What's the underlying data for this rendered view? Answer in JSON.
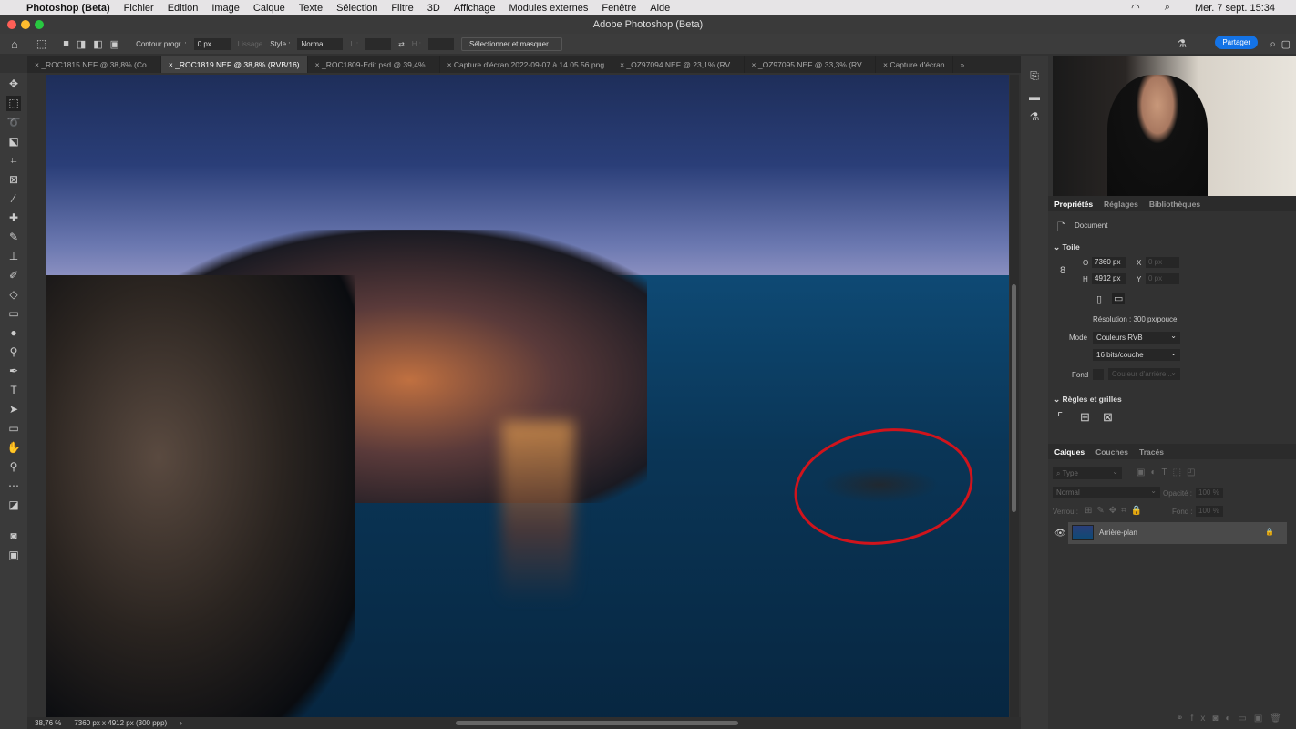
{
  "menubar": {
    "apple": "",
    "app": "Photoshop (Beta)",
    "items": [
      "Fichier",
      "Edition",
      "Image",
      "Calque",
      "Texte",
      "Sélection",
      "Filtre",
      "3D",
      "Affichage",
      "Modules externes",
      "Fenêtre",
      "Aide"
    ],
    "clock": "Mer. 7 sept.  15:34"
  },
  "window": {
    "title": "Adobe Photoshop (Beta)"
  },
  "options": {
    "feather_label": "Contour progr. :",
    "feather_value": "0 px",
    "smooth": "Lissage",
    "style_label": "Style :",
    "style_value": "Normal",
    "w_label": "L :",
    "h_label": "H :",
    "select_mask": "Sélectionner et masquer...",
    "share": "Partager"
  },
  "tabs": [
    "_ROC1815.NEF @ 38,8% (Co...",
    "_ROC1819.NEF @ 38,8% (RVB/16)",
    "_ROC1809-Edit.psd @ 39,4%...",
    "Capture d'écran 2022-09-07 à 14.05.56.png",
    "_OZ97094.NEF @ 23,1% (RV...",
    "_OZ97095.NEF @ 33,3% (RV...",
    "Capture d'écran"
  ],
  "active_tab": 1,
  "status": {
    "zoom": "38,76 %",
    "doc": "7360 px x 4912 px (300 ppp)",
    "arrow": "›"
  },
  "annotation_color": "#d0141c",
  "properties": {
    "tabs": [
      "Propriétés",
      "Réglages",
      "Bibliothèques"
    ],
    "doc_label": "Document",
    "section": "Toile",
    "w_label": "O",
    "w_value": "7360 px",
    "h_label": "H",
    "h_value": "4912 px",
    "x_label": "X",
    "x_value": "0 px",
    "y_label": "Y",
    "y_value": "0 px",
    "resolution": "Résolution : 300 px/pouce",
    "mode_label": "Mode",
    "mode_value": "Couleurs RVB",
    "depth_value": "16 bits/couche",
    "fond_label": "Fond",
    "fond_value": "Couleur d'arrière...",
    "rules_section": "Règles et grilles"
  },
  "layers": {
    "tabs": [
      "Calques",
      "Couches",
      "Tracés"
    ],
    "filter_placeholder": "Type",
    "blend": "Normal",
    "opacity_label": "Opacité :",
    "opacity_value": "100 %",
    "lock_label": "Verrou :",
    "fill_label": "Fond :",
    "fill_value": "100 %",
    "items": [
      {
        "name": "Arrière-plan",
        "visible": true,
        "locked": true
      }
    ]
  }
}
